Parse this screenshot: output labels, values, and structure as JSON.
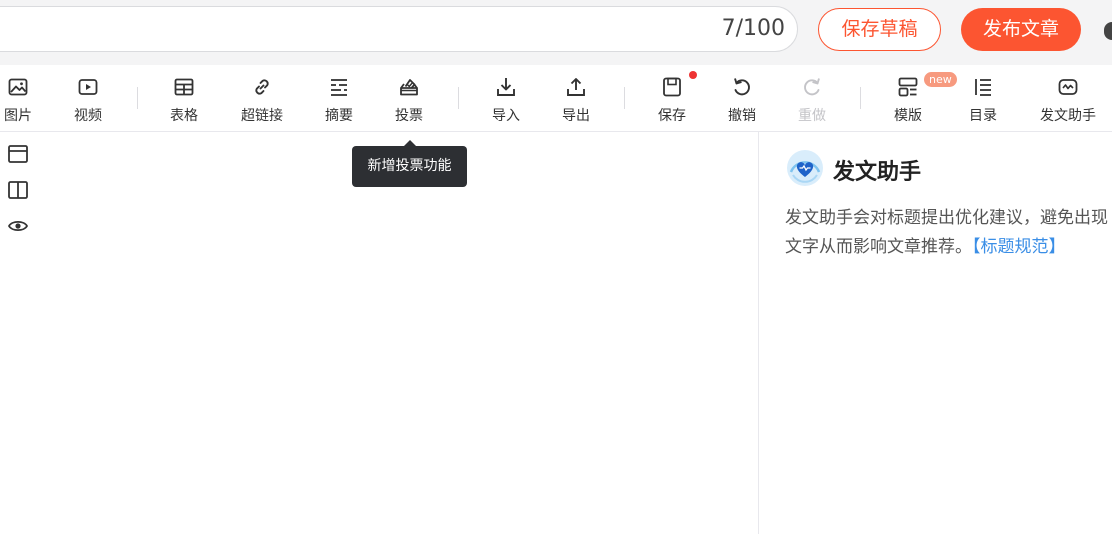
{
  "header": {
    "title_counter": "7/100",
    "save_draft_label": "保存草稿",
    "publish_label": "发布文章"
  },
  "toolbar": {
    "items": [
      {
        "label": "图片",
        "icon": "image-icon"
      },
      {
        "label": "视频",
        "icon": "video-icon"
      },
      {
        "label": "表格",
        "icon": "table-icon"
      },
      {
        "label": "超链接",
        "icon": "link-icon"
      },
      {
        "label": "摘要",
        "icon": "summary-icon"
      },
      {
        "label": "投票",
        "icon": "vote-icon"
      },
      {
        "label": "导入",
        "icon": "import-icon"
      },
      {
        "label": "导出",
        "icon": "export-icon"
      },
      {
        "label": "保存",
        "icon": "save-icon"
      },
      {
        "label": "撤销",
        "icon": "undo-icon"
      },
      {
        "label": "重做",
        "icon": "redo-icon"
      },
      {
        "label": "模版",
        "icon": "template-icon"
      },
      {
        "label": "目录",
        "icon": "toc-icon"
      },
      {
        "label": "发文助手",
        "icon": "assistant-icon"
      }
    ],
    "new_badge": "new",
    "tooltip": "新增投票功能"
  },
  "assistant": {
    "title": "发文助手",
    "text_line1": "发文助手会对标题提出优化建议，避免出现",
    "text_line2": "文字从而影响文章推荐。",
    "link_label": "【标题规范】"
  },
  "colors": {
    "accent": "#fc5531",
    "link": "#3a8ee6",
    "dot": "#ee3333"
  }
}
